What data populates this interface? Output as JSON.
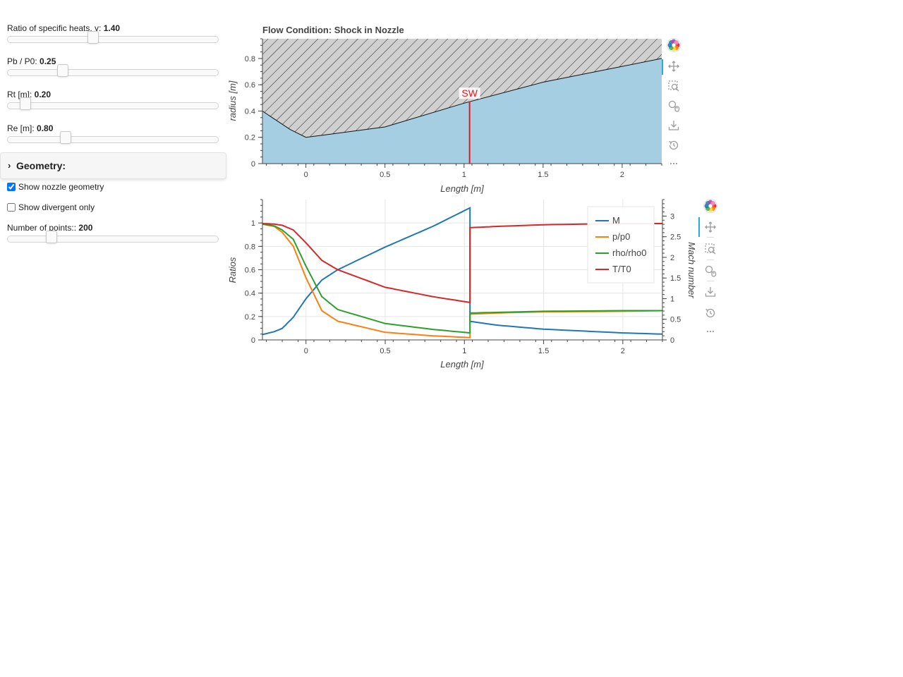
{
  "sliders": [
    {
      "label": "Ratio of specific heats, γ: ",
      "value": "1.40",
      "position": 0.4
    },
    {
      "label": "Pb / P0: ",
      "value": "0.25",
      "position": 0.25
    },
    {
      "label": "Rt [m]: ",
      "value": "0.20",
      "position": 0.065
    },
    {
      "label": "Re [m]: ",
      "value": "0.80",
      "position": 0.265
    }
  ],
  "geometry_section": {
    "title": "Geometry:",
    "expanded": false
  },
  "checkboxes": [
    {
      "label": "Show nozzle geometry",
      "checked": true
    },
    {
      "label": "Show divergent only",
      "checked": false
    }
  ],
  "points_slider": {
    "label": "Number of points:: ",
    "value": "200",
    "position": 0.195
  },
  "toolbar_icons": [
    "bokeh-logo-icon",
    "pan-icon",
    "box-zoom-icon",
    "wheel-zoom-icon",
    "save-icon",
    "reset-icon",
    "more-icon"
  ],
  "colors": {
    "M": "#1f77b4",
    "p/p0": "#ff7f0e",
    "rho/rho0": "#2ca02c",
    "T/T0": "#d62728",
    "flow": "#a6cee3",
    "shock": "#e31a1c"
  },
  "chart_data": [
    {
      "type": "area",
      "title": "Flow Condition: Shock in Nozzle",
      "xlabel": "Length [m]",
      "ylabel": "radius [m]",
      "xlim": [
        -0.275,
        2.25
      ],
      "ylim": [
        0,
        0.95
      ],
      "x_ticks": [
        "0",
        "0.5",
        "1",
        "1.5",
        "2"
      ],
      "y_ticks": [
        "0",
        "0.2",
        "0.4",
        "0.6",
        "0.8"
      ],
      "series": [
        {
          "values": [
            [
              -0.275,
              0.4
            ],
            [
              -0.2,
              0.34
            ],
            [
              -0.1,
              0.26
            ],
            [
              0,
              0.2
            ],
            [
              0.1,
              0.215
            ],
            [
              0.5,
              0.279
            ],
            [
              1.0,
              0.46
            ],
            [
              1.5,
              0.62
            ],
            [
              2.0,
              0.74
            ],
            [
              2.25,
              0.8
            ]
          ]
        }
      ],
      "annotations": [
        {
          "text": "SW",
          "x": 1.035
        }
      ]
    },
    {
      "type": "line",
      "xlabel": "Length [m]",
      "ylabel": "Ratios",
      "ylabel_right": "Mach number",
      "xlim": [
        -0.275,
        2.25
      ],
      "ylim": [
        0,
        1.2
      ],
      "ylim_right": [
        0,
        3.4
      ],
      "x_ticks": [
        "0",
        "0.5",
        "1",
        "1.5",
        "2"
      ],
      "y_ticks": [
        "0",
        "0.2",
        "0.4",
        "0.6",
        "0.8",
        "1"
      ],
      "y_ticks_right": [
        "0",
        "0.5",
        "1",
        "1.5",
        "2",
        "2.5",
        "3"
      ],
      "legend_position": "top-right",
      "series": [
        {
          "name": "M",
          "axis": "right",
          "x": [
            -0.275,
            -0.2,
            -0.15,
            -0.08,
            0,
            0.1,
            0.2,
            0.5,
            0.8,
            1.035,
            1.035,
            1.2,
            1.5,
            2.0,
            2.25
          ],
          "values": [
            0.13,
            0.2,
            0.28,
            0.55,
            1.0,
            1.45,
            1.7,
            2.25,
            2.75,
            3.2,
            0.45,
            0.36,
            0.26,
            0.17,
            0.14
          ]
        },
        {
          "name": "p/p0",
          "axis": "left",
          "x": [
            -0.275,
            -0.2,
            -0.15,
            -0.08,
            0,
            0.1,
            0.2,
            0.5,
            0.8,
            1.035,
            1.035,
            1.2,
            1.5,
            2.0,
            2.25
          ],
          "values": [
            0.99,
            0.97,
            0.92,
            0.8,
            0.53,
            0.25,
            0.16,
            0.065,
            0.035,
            0.02,
            0.22,
            0.23,
            0.24,
            0.245,
            0.25
          ]
        },
        {
          "name": "rho/rho0",
          "axis": "left",
          "x": [
            -0.275,
            -0.2,
            -0.15,
            -0.08,
            0,
            0.1,
            0.2,
            0.5,
            0.8,
            1.035,
            1.035,
            1.2,
            1.5,
            2.0,
            2.25
          ],
          "values": [
            0.99,
            0.975,
            0.94,
            0.86,
            0.63,
            0.37,
            0.26,
            0.14,
            0.09,
            0.06,
            0.23,
            0.235,
            0.245,
            0.25,
            0.25
          ]
        },
        {
          "name": "T/T0",
          "axis": "left",
          "x": [
            -0.275,
            -0.2,
            -0.15,
            -0.08,
            0,
            0.1,
            0.2,
            0.5,
            0.8,
            1.035,
            1.035,
            1.2,
            1.5,
            2.0,
            2.25
          ],
          "values": [
            0.995,
            0.99,
            0.98,
            0.94,
            0.83,
            0.68,
            0.6,
            0.45,
            0.37,
            0.32,
            0.96,
            0.97,
            0.985,
            0.995,
            0.995
          ]
        }
      ]
    }
  ]
}
